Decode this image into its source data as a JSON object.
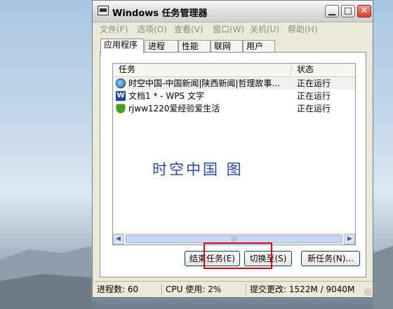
{
  "window": {
    "title": "Windows 任务管理器"
  },
  "menu": [
    "文件(F)",
    "选项(O)",
    "查看(V)",
    "窗口(W)",
    "关机(U)",
    "帮助(H)"
  ],
  "tabs": [
    "应用程序",
    "进程",
    "性能",
    "联网",
    "用户"
  ],
  "list": {
    "headers": {
      "task": "任务",
      "status": "状态"
    },
    "rows": [
      {
        "name": "时空中国-中国新闻|陕西新闻|哲理故事...",
        "status": "正在运行",
        "icon": "globe-icon"
      },
      {
        "name": "文档1 * - WPS 文字",
        "status": "正在运行",
        "icon": "wps-icon"
      },
      {
        "name": "rjww1220爱经验爱生活",
        "status": "正在运行",
        "icon": "certificate-icon"
      }
    ],
    "watermark": "时空中国 图"
  },
  "buttons": {
    "end_task": "结束任务(E)",
    "switch_to": "切换至(S)",
    "new_task": "新任务(N)..."
  },
  "statusbar": {
    "processes": "进程数: 60",
    "cpu": "CPU 使用: 2%",
    "commit": "提交更改: 1522M / 9040M"
  },
  "colors": {
    "highlight_border": "#d2001d",
    "list_border": "#7f9db9",
    "watermark_text": "#274b9e"
  }
}
